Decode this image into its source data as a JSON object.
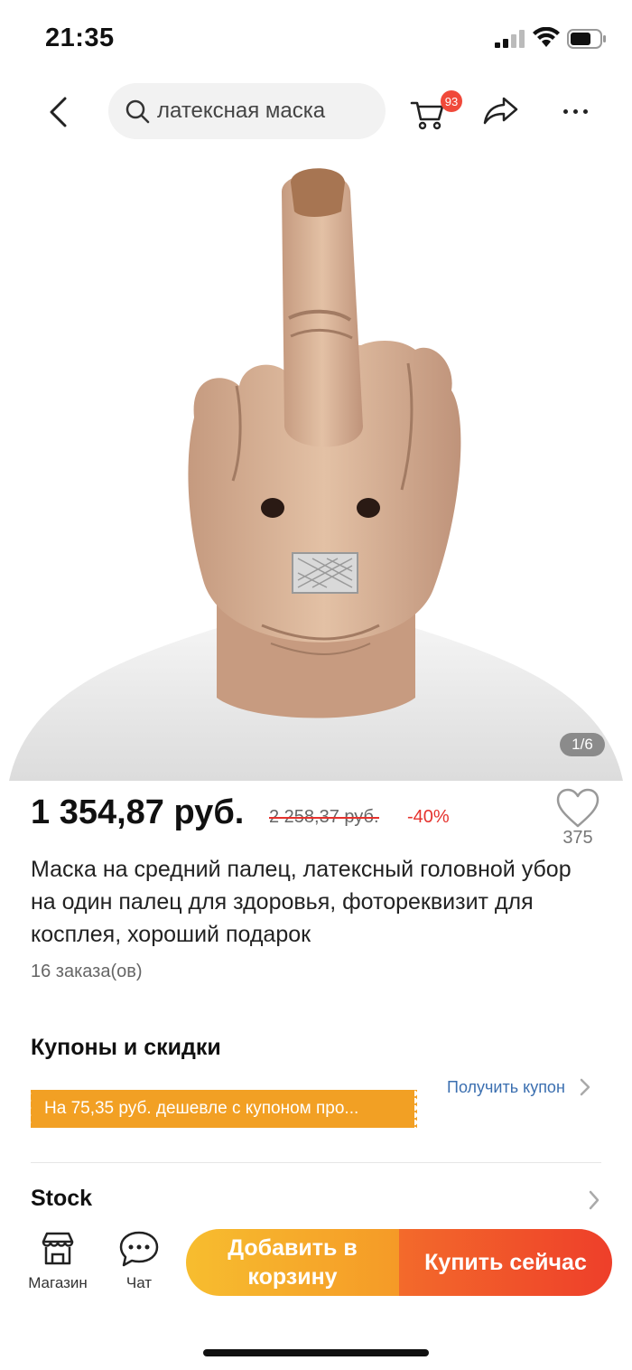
{
  "status_bar": {
    "time": "21:35"
  },
  "nav": {
    "search_query": "латексная маска",
    "cart_badge": "93",
    "icons": [
      "back-chevron-icon",
      "search-icon",
      "cart-icon",
      "share-icon",
      "more-icon"
    ]
  },
  "product": {
    "image_counter": "1/6",
    "price": "1 354,87 руб.",
    "old_price": "2 258,37 руб.",
    "discount": "-40%",
    "wishlist_count": "375",
    "title": "Маска на средний палец, латексный головной убор на один палец для здоровья, фотореквизит для косплея, хороший подарок",
    "orders": "16 заказа(ов)"
  },
  "coupons": {
    "heading": "Купоны и скидки",
    "get_coupon": "Получить купон",
    "banner": "На 75,35 руб. дешевле с купоном про..."
  },
  "stock": {
    "label": "Stock"
  },
  "bottom_bar": {
    "shop_label": "Магазин",
    "chat_label": "Чат",
    "add_to_cart": "Добавить в корзину",
    "buy_now": "Купить сейчас"
  },
  "colors": {
    "accent_red": "#e5322d",
    "coupon_orange": "#f2a024",
    "add_cart_gradient": [
      "#f7bd2f",
      "#f59a27"
    ],
    "buy_now_gradient": [
      "#f36a2b",
      "#ee3f2a"
    ],
    "link_blue": "#3b6fb0"
  }
}
